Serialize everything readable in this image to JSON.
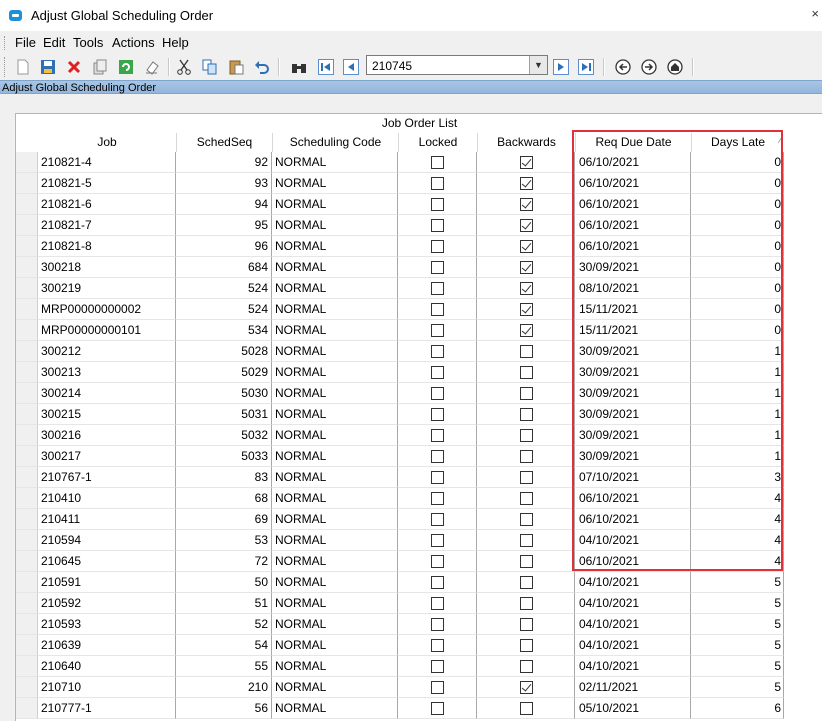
{
  "window": {
    "title": "Adjust Global Scheduling Order",
    "close": "×"
  },
  "menu": [
    "File",
    "Edit",
    "Tools",
    "Actions",
    "Help"
  ],
  "toolbar": {
    "job_value": "210745",
    "icons": [
      "new-icon",
      "save-icon",
      "delete-icon",
      "copy-icon",
      "refresh-icon",
      "clear-icon",
      "cut-icon",
      "copy2-icon",
      "paste-icon",
      "undo-icon",
      "find-icon",
      "first-icon",
      "prev-icon",
      "next-icon",
      "last-icon",
      "back-icon",
      "forward-icon",
      "home-icon"
    ]
  },
  "form_caption": "Adjust Global Scheduling Order",
  "grid": {
    "title": "Job Order List",
    "columns": [
      "Job",
      "SchedSeq",
      "Scheduling Code",
      "Locked",
      "Backwards",
      "Req Due Date",
      "Days Late"
    ],
    "sort_indicator": "⁄",
    "rows": [
      {
        "job": "210821-4",
        "seq": "92",
        "code": "NORMAL",
        "locked": false,
        "back": true,
        "due": "06/10/2021",
        "late": "0"
      },
      {
        "job": "210821-5",
        "seq": "93",
        "code": "NORMAL",
        "locked": false,
        "back": true,
        "due": "06/10/2021",
        "late": "0"
      },
      {
        "job": "210821-6",
        "seq": "94",
        "code": "NORMAL",
        "locked": false,
        "back": true,
        "due": "06/10/2021",
        "late": "0"
      },
      {
        "job": "210821-7",
        "seq": "95",
        "code": "NORMAL",
        "locked": false,
        "back": true,
        "due": "06/10/2021",
        "late": "0"
      },
      {
        "job": "210821-8",
        "seq": "96",
        "code": "NORMAL",
        "locked": false,
        "back": true,
        "due": "06/10/2021",
        "late": "0"
      },
      {
        "job": "300218",
        "seq": "684",
        "code": "NORMAL",
        "locked": false,
        "back": true,
        "due": "30/09/2021",
        "late": "0"
      },
      {
        "job": "300219",
        "seq": "524",
        "code": "NORMAL",
        "locked": false,
        "back": true,
        "due": "08/10/2021",
        "late": "0"
      },
      {
        "job": "MRP00000000002",
        "seq": "524",
        "code": "NORMAL",
        "locked": false,
        "back": true,
        "due": "15/11/2021",
        "late": "0"
      },
      {
        "job": "MRP00000000101",
        "seq": "534",
        "code": "NORMAL",
        "locked": false,
        "back": true,
        "due": "15/11/2021",
        "late": "0"
      },
      {
        "job": "300212",
        "seq": "5028",
        "code": "NORMAL",
        "locked": false,
        "back": false,
        "due": "30/09/2021",
        "late": "1"
      },
      {
        "job": "300213",
        "seq": "5029",
        "code": "NORMAL",
        "locked": false,
        "back": false,
        "due": "30/09/2021",
        "late": "1"
      },
      {
        "job": "300214",
        "seq": "5030",
        "code": "NORMAL",
        "locked": false,
        "back": false,
        "due": "30/09/2021",
        "late": "1"
      },
      {
        "job": "300215",
        "seq": "5031",
        "code": "NORMAL",
        "locked": false,
        "back": false,
        "due": "30/09/2021",
        "late": "1"
      },
      {
        "job": "300216",
        "seq": "5032",
        "code": "NORMAL",
        "locked": false,
        "back": false,
        "due": "30/09/2021",
        "late": "1"
      },
      {
        "job": "300217",
        "seq": "5033",
        "code": "NORMAL",
        "locked": false,
        "back": false,
        "due": "30/09/2021",
        "late": "1"
      },
      {
        "job": "210767-1",
        "seq": "83",
        "code": "NORMAL",
        "locked": false,
        "back": false,
        "due": "07/10/2021",
        "late": "3"
      },
      {
        "job": "210410",
        "seq": "68",
        "code": "NORMAL",
        "locked": false,
        "back": false,
        "due": "06/10/2021",
        "late": "4"
      },
      {
        "job": "210411",
        "seq": "69",
        "code": "NORMAL",
        "locked": false,
        "back": false,
        "due": "06/10/2021",
        "late": "4"
      },
      {
        "job": "210594",
        "seq": "53",
        "code": "NORMAL",
        "locked": false,
        "back": false,
        "due": "04/10/2021",
        "late": "4"
      },
      {
        "job": "210645",
        "seq": "72",
        "code": "NORMAL",
        "locked": false,
        "back": false,
        "due": "06/10/2021",
        "late": "4"
      },
      {
        "job": "210591",
        "seq": "50",
        "code": "NORMAL",
        "locked": false,
        "back": false,
        "due": "04/10/2021",
        "late": "5"
      },
      {
        "job": "210592",
        "seq": "51",
        "code": "NORMAL",
        "locked": false,
        "back": false,
        "due": "04/10/2021",
        "late": "5"
      },
      {
        "job": "210593",
        "seq": "52",
        "code": "NORMAL",
        "locked": false,
        "back": false,
        "due": "04/10/2021",
        "late": "5"
      },
      {
        "job": "210639",
        "seq": "54",
        "code": "NORMAL",
        "locked": false,
        "back": false,
        "due": "04/10/2021",
        "late": "5"
      },
      {
        "job": "210640",
        "seq": "55",
        "code": "NORMAL",
        "locked": false,
        "back": false,
        "due": "04/10/2021",
        "late": "5"
      },
      {
        "job": "210710",
        "seq": "210",
        "code": "NORMAL",
        "locked": false,
        "back": true,
        "due": "02/11/2021",
        "late": "5"
      },
      {
        "job": "210777-1",
        "seq": "56",
        "code": "NORMAL",
        "locked": false,
        "back": false,
        "due": "05/10/2021",
        "late": "6"
      }
    ]
  },
  "highlight_color": "#e0303a"
}
